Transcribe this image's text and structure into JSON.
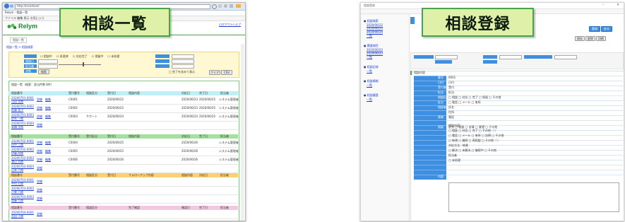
{
  "colors": {
    "accent_blue": "#3f8fe0",
    "header_cyan": "#bfeef5",
    "header_green": "#a6e0a0",
    "header_orange": "#ffcf75",
    "header_pink": "#f6c7e1",
    "badge_bg": "#dff1a8",
    "badge_border": "#4aa34a",
    "brand_green": "#1e8a2e"
  },
  "icons": [
    "back-arrow-icon",
    "forward-arrow-icon",
    "refresh-icon",
    "search-icon",
    "star-icon",
    "settings-icon",
    "relym-logo-icon",
    "checkbox-icon"
  ],
  "left_window": {
    "badge": "相談一覧",
    "logo": "Relym",
    "browser_address": "http://localhost/",
    "browser_tab": "Relym - 相談一覧",
    "menu": "ファイル  編集  表示  お気に入り",
    "nav": "相談一覧",
    "breadcrumb": "相談一覧 > 相談検索",
    "header_links": [
      "ログアウト",
      "ヘルプ"
    ],
    "filter_checks": [
      "相談中",
      "処理済",
      "対応完了",
      "保留中",
      "未処理"
    ],
    "filter_labels": [
      "相談日",
      "担当者",
      "状態"
    ],
    "search_button": "検索",
    "clear_button": "クリア",
    "csv_button": "CSV",
    "search_hint": "□ 完了を含めて表示",
    "list_title": "相談一覧（検索：該当件数 8件）",
    "section1_cols": [
      "相談番号",
      "",
      "",
      "受付番号",
      "相談区分",
      "受付日",
      "相談内容",
      "",
      "対応日",
      "完了日",
      "担当者"
    ],
    "section1_rows": [
      {
        "num": "20200701-0001",
        "sub": "山田 太郎",
        "c1": "詳細",
        "c2": "編集",
        "code": "C0001",
        "date1": "2020/06/22",
        "date2": "2020/06/23",
        "date3": "2020/06/25",
        "name": "システム管理者"
      },
      {
        "num": "20200701-0002",
        "sub": "佐藤 花子",
        "c1": "詳細",
        "c2": "編集",
        "code": "C0002",
        "date1": "2020/06/22",
        "date2": "2020/06/23",
        "date3": "2020/06/25",
        "name": "システム管理者"
      },
      {
        "num": "20200701-0003",
        "sub": "鈴木 一郎",
        "c1": "詳細",
        "c2": "編集",
        "code": "C0003",
        "cat": "サポート",
        "date1": "2020/06/24",
        "date2": "2020/06/24",
        "date3": "2020/06/25",
        "name": "システム管理者"
      },
      {
        "num": "20200701-0004",
        "sub": "高橋 次郎",
        "c1": "詳細"
      }
    ],
    "section2_cols": [
      "相談番号",
      "",
      "",
      "受付番号",
      "受付区分",
      "受付日",
      "相談内容",
      "",
      "対応日",
      "完了日",
      "担当者"
    ],
    "section2_rows": [
      {
        "num": "20200702-0001",
        "sub": "田中 三郎",
        "c1": "詳細",
        "c2": "編集",
        "code": "C0004",
        "date1": "2020/06/25",
        "date2": "2020/06/26",
        "name": "システム管理者"
      },
      {
        "num": "20200702-0002",
        "sub": "伊藤 四郎",
        "c1": "詳細",
        "c2": "編集",
        "code": "C0005",
        "date1": "2020/06/25",
        "date2": "2020/06/26",
        "name": "システム管理者"
      },
      {
        "num": "20200702-0003",
        "sub": "渡辺 五郎",
        "c1": "詳細",
        "c2": "編集",
        "code": "C0006",
        "date1": "2020/06/26",
        "date2": "2020/06/26",
        "name": "システム管理者"
      },
      {
        "num": "20200702-0004",
        "sub": "山本 六郎",
        "c1": "詳細"
      }
    ],
    "section3_cols": [
      "相談番号",
      "",
      "",
      "受付番号",
      "相談区分",
      "受付日",
      "フォローアップ内容",
      "",
      "相談内容",
      "対応日",
      "担当者"
    ],
    "section3_rows": [
      {
        "num": "20200703-0001",
        "sub": "中村 七郎",
        "c1": "詳細"
      },
      {
        "num": "20200703-0002",
        "sub": "小林 八郎",
        "c1": "詳細"
      },
      {
        "num": "20200703-0003",
        "sub": "加藤 九郎",
        "c1": "詳細"
      }
    ],
    "section4_cols": [
      "相談番号",
      "",
      "",
      "受付番号",
      "相談区分",
      "",
      "完了確認",
      "",
      "確認日",
      "完了日",
      "担当者"
    ],
    "section4_rows": [
      {
        "num": "20200704-0001",
        "sub": "吉田 十郎",
        "c1": "詳細"
      }
    ]
  },
  "right_window": {
    "badge": "相談登録",
    "browser_tab": "相談登録",
    "side_groups": [
      {
        "title": "● 相談検索",
        "items": [
          "2020/06/22",
          "2020/06/23",
          "2020/06/24"
        ],
        "link": "一覧"
      },
      {
        "title": "● 関連項目",
        "items": [
          "2020/06/22",
          "2020/06/23"
        ],
        "link": "一覧"
      },
      {
        "title": "● 相談記録",
        "items": [],
        "link": "一覧"
      },
      {
        "title": "● 相談情報",
        "items": [],
        "link": "一覧"
      },
      {
        "title": "● 相談履歴",
        "items": [],
        "link": "一覧"
      }
    ],
    "top_buttons": [
      "登録",
      "戻る"
    ],
    "sub_buttons": [
      "保存",
      "削除",
      "印刷"
    ],
    "section_title": "相談内容",
    "form_labels": [
      "番号",
      "日付",
      "受付者",
      "担当",
      "相談区分",
      "区分",
      "相談者",
      "",
      "連絡",
      "",
      "相談",
      "",
      "",
      "",
      "",
      "",
      "",
      "",
      "",
      "",
      "内容"
    ],
    "form_values": [
      "0001",
      "日付",
      "受付",
      "担当",
      "□ 相談 □ 対応 □ 完了 □ 保留 □ その他",
      "□ 電話 □ メール □ 来所",
      "氏名",
      "住所",
      "電話",
      "",
      "区分 □ 相談 □ 苦情 □ 要望 □ その他",
      "",
      "",
      "",
      "",
      "",
      "",
      "",
      "",
      "",
      ""
    ],
    "detail_lines": [
      "相談内容：",
      "□ 相談 □ 対応 □ 完了 □ その他（ ）",
      "□ 電話 □ メール □ 来所 □ 訪問 □ その他",
      "□ 新規 □ 継続 □ 再相談 □ その他（ ）",
      "対応方法・結果",
      "□ 解決 □ 未解決 □ 継続中 □ その他",
      "担当者",
      "□ 未処理"
    ]
  }
}
